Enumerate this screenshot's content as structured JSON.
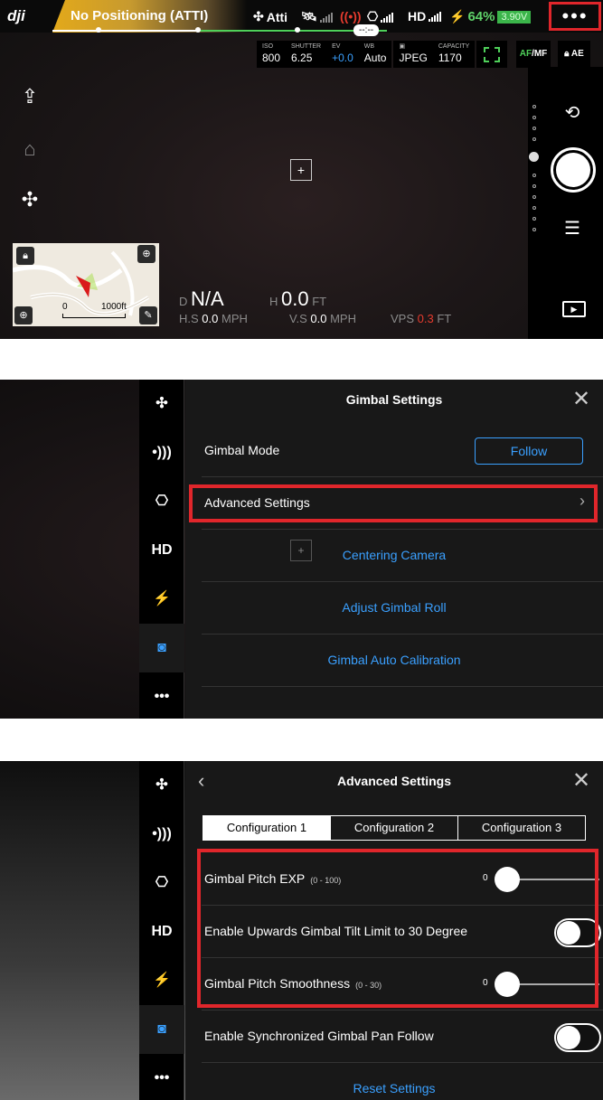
{
  "panel1": {
    "logo": "dji",
    "status": "No Positioning (ATTI)",
    "flight_mode": "Atti",
    "video_link": "HD",
    "battery_percent": "64%",
    "voltage": "3.90V",
    "more_menu": "•••",
    "timeline_label": "--:--",
    "camera": {
      "iso_label": "ISO",
      "iso": "800",
      "shutter_label": "SHUTTER",
      "shutter": "6.25",
      "ev_label": "EV",
      "ev": "+0.0",
      "wb_label": "WB",
      "wb": "Auto",
      "format": "JPEG",
      "capacity_label": "CAPACITY",
      "capacity": "1170"
    },
    "af_mf_a": "AF",
    "af_mf_b": "/MF",
    "ae": "AE",
    "map_scale_start": "0",
    "map_scale_end": "1000ft",
    "telemetry": {
      "d_label": "D",
      "d_value": "N/A",
      "h_label": "H",
      "h_value": "0.0",
      "h_unit": "FT",
      "hs_label": "H.S",
      "hs_value": "0.0",
      "hs_unit": "MPH",
      "vs_label": "V.S",
      "vs_value": "0.0",
      "vs_unit": "MPH",
      "vps_label": "VPS",
      "vps_value": "0.3",
      "vps_unit": "FT"
    }
  },
  "panel2": {
    "title": "Gimbal Settings",
    "gimbal_mode_label": "Gimbal Mode",
    "gimbal_mode_value": "Follow",
    "advanced_settings": "Advanced Settings",
    "centering_camera": "Centering Camera",
    "adjust_roll": "Adjust Gimbal Roll",
    "auto_calibration": "Gimbal Auto Calibration",
    "sidebar_hd": "HD",
    "sidebar_more": "•••"
  },
  "panel3": {
    "title": "Advanced Settings",
    "tabs": [
      "Configuration 1",
      "Configuration 2",
      "Configuration 3"
    ],
    "pitch_exp_label": "Gimbal Pitch EXP",
    "pitch_exp_range": "(0 - 100)",
    "pitch_exp_value": "0",
    "tilt_limit_label": "Enable Upwards Gimbal Tilt Limit to 30 Degree",
    "tilt_limit_on": false,
    "smoothness_label": "Gimbal Pitch Smoothness",
    "smoothness_range": "(0 - 30)",
    "smoothness_value": "0",
    "sync_pan_label": "Enable Synchronized Gimbal Pan Follow",
    "sync_pan_on": false,
    "reset": "Reset Settings",
    "sidebar_hd": "HD",
    "sidebar_more": "•••"
  },
  "colors": {
    "accent": "#3aa0ff",
    "highlight": "#e0262b",
    "battery": "#5fd36a"
  },
  "icons": [
    "home-icon",
    "return-home-icon",
    "aircraft-icon",
    "radio-icon",
    "remote-controller-icon",
    "battery-icon",
    "camera-switch-icon",
    "shutter-icon",
    "settings-sliders-icon",
    "playback-icon",
    "lock-icon",
    "target-icon",
    "zoom-icon",
    "eraser-icon",
    "close-icon",
    "chevron-right-icon",
    "chevron-left-icon",
    "camera-icon"
  ]
}
